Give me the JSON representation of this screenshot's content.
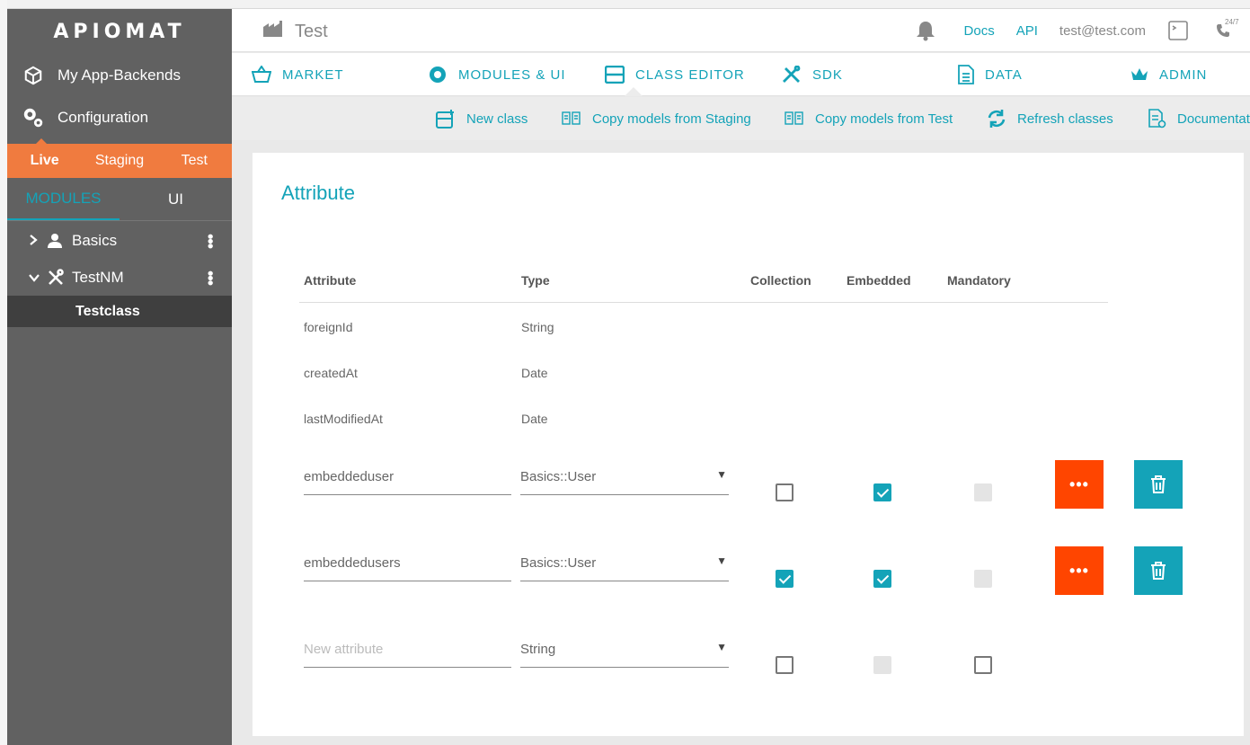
{
  "brand": {
    "logo_text": "APIOMAT"
  },
  "sidebar": {
    "nav": [
      {
        "label": "My App-Backends",
        "icon": "cube-icon"
      },
      {
        "label": "Configuration",
        "icon": "gears-icon"
      }
    ],
    "env_tabs": [
      "Live",
      "Staging",
      "Test"
    ],
    "active_env": "Live",
    "mod_tabs": [
      "MODULES",
      "UI"
    ],
    "tree": [
      {
        "label": "Basics",
        "icon": "user-icon",
        "expanded": false
      },
      {
        "label": "TestNM",
        "icon": "tools-icon",
        "expanded": true
      }
    ],
    "tree_leaf": "Testclass"
  },
  "header": {
    "app_name": "Test",
    "docs": "Docs",
    "api": "API",
    "email": "test@test.com",
    "phone_badge": "24/7"
  },
  "mainnav": {
    "items": [
      "MARKET",
      "MODULES & UI",
      "CLASS EDITOR",
      "SDK",
      "DATA",
      "ADMIN"
    ],
    "active": "CLASS EDITOR"
  },
  "subbar": {
    "items": [
      "New class",
      "Copy models from Staging",
      "Copy models from Test",
      "Refresh classes",
      "Documentat"
    ]
  },
  "card": {
    "title": "Attribute",
    "columns": [
      "Attribute",
      "Type",
      "Collection",
      "Embedded",
      "Mandatory"
    ],
    "static_rows": [
      {
        "name": "foreignId",
        "type": "String"
      },
      {
        "name": "createdAt",
        "type": "Date"
      },
      {
        "name": "lastModifiedAt",
        "type": "Date"
      }
    ],
    "edit_rows": [
      {
        "name": "embeddeduser",
        "type": "Basics::User",
        "collection": false,
        "embedded": true,
        "mandatory": "disabled"
      },
      {
        "name": "embeddedusers",
        "type": "Basics::User",
        "collection": true,
        "embedded": true,
        "mandatory": "disabled"
      }
    ],
    "new_row": {
      "placeholder": "New attribute",
      "type": "String"
    },
    "more_label": "•••"
  },
  "colors": {
    "accent": "#14a3b8",
    "orange": "#f07b3f",
    "danger": "#ff4500",
    "sidebar": "#616161"
  }
}
